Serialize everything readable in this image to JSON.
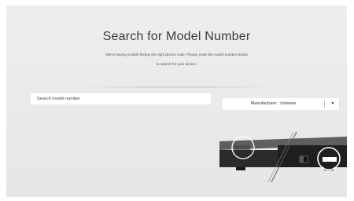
{
  "dialog": {
    "title": "Search for Model Number",
    "subtitle_line1": "We're having trouble finding the right device code. Please enter the model number below",
    "subtitle_line2": "to search for your device."
  },
  "search": {
    "placeholder": "Search model number",
    "value": ""
  },
  "manufacturer_dropdown": {
    "label": "Manufacturer : Unkown",
    "chevron": "▼"
  },
  "illustration": {
    "description_icon": "set-top-box-icon",
    "colors": {
      "device_body": "#2b2b2b",
      "device_top": "#5f5f5f",
      "highlight_circle": "#ffffff"
    }
  },
  "colors": {
    "background": "#eeeeee",
    "title_text": "#3b3b3b",
    "field_background": "#ffffff"
  }
}
